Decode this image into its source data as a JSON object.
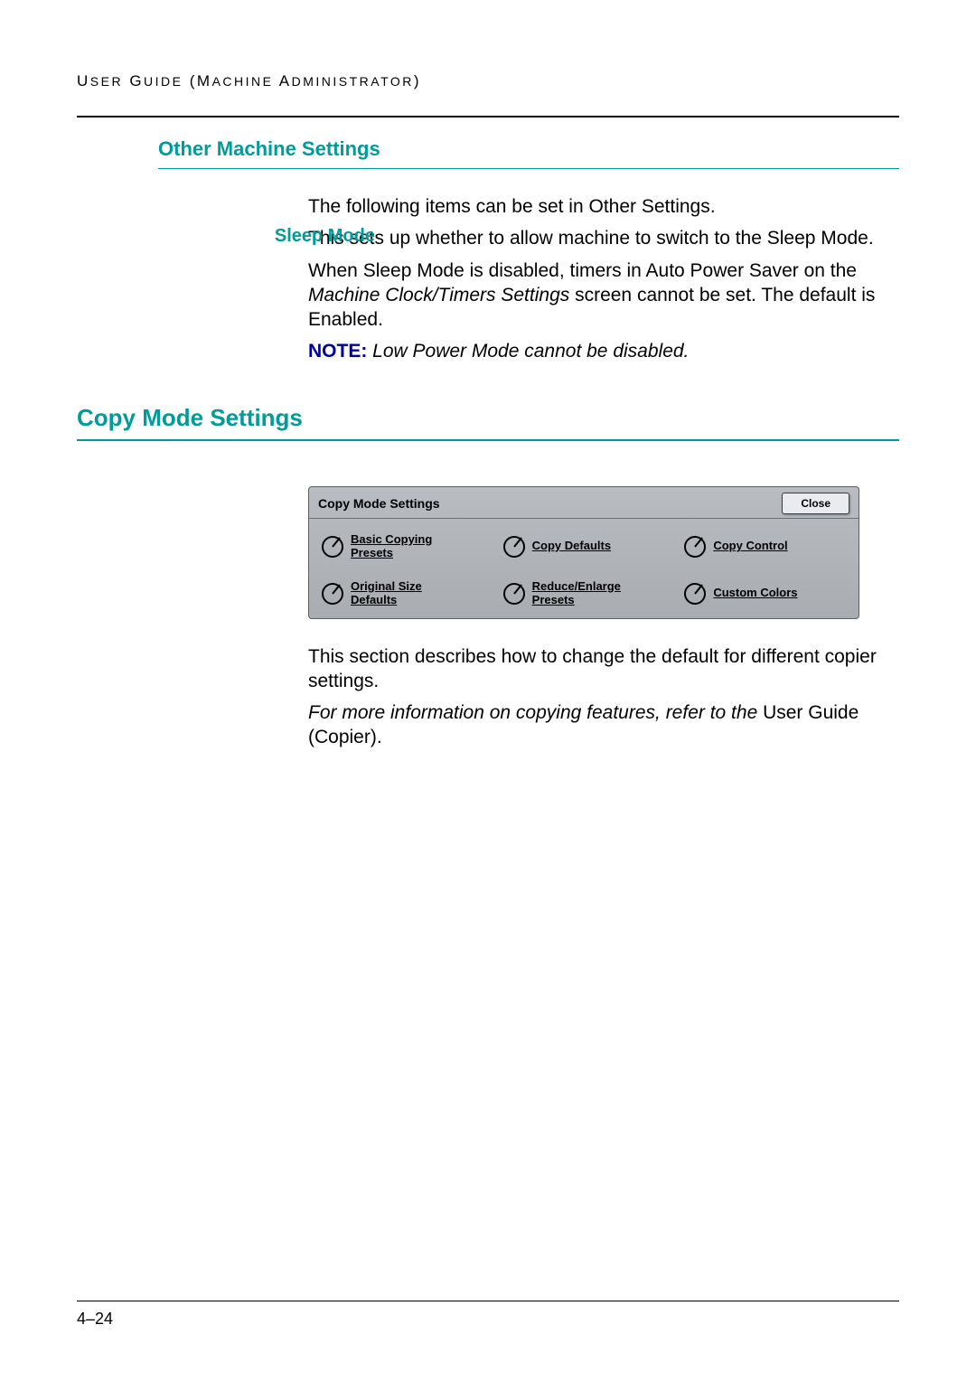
{
  "header_prefix": "U",
  "header_small1": "SER",
  "header_space1": " G",
  "header_small2": "UIDE",
  "header_space2": " (M",
  "header_small3": "ACHINE",
  "header_space3": " A",
  "header_small4": "DMINISTRATOR",
  "header_suffix": ")",
  "section_other_title": "Other Machine Settings",
  "other_intro": "The following items can be set in Other Settings.",
  "sleep_mode_label": "Sleep Mode",
  "sleep_mode_p1": "This sets up whether to allow machine to switch to the Sleep Mode.",
  "sleep_mode_p2a": "When Sleep Mode is disabled, timers in Auto Power Saver on the ",
  "sleep_mode_p2_italic": "Machine Clock/Timers Settings",
  "sleep_mode_p2b": " screen cannot be set. The default is Enabled.",
  "note_label": "NOTE:",
  "note_text": " Low Power Mode cannot be disabled.",
  "section_copy_title": "Copy Mode Settings",
  "panel": {
    "title": "Copy Mode Settings",
    "close": "Close",
    "options": [
      {
        "label_l1": "Basic Copying",
        "label_l2": "Presets"
      },
      {
        "label_l1": "Copy Defaults",
        "label_l2": ""
      },
      {
        "label_l1": "Copy Control",
        "label_l2": ""
      },
      {
        "label_l1": "Original Size",
        "label_l2": "Defaults"
      },
      {
        "label_l1": "Reduce/Enlarge",
        "label_l2": "Presets"
      },
      {
        "label_l1": "Custom Colors",
        "label_l2": ""
      }
    ]
  },
  "copy_desc_p1": "This section describes how to change the default for different copier settings.",
  "copy_desc_p2_italic": "For more information on copying features, refer to the",
  "copy_desc_p2_plain": " User Guide (Copier).",
  "page_number": "4–24"
}
